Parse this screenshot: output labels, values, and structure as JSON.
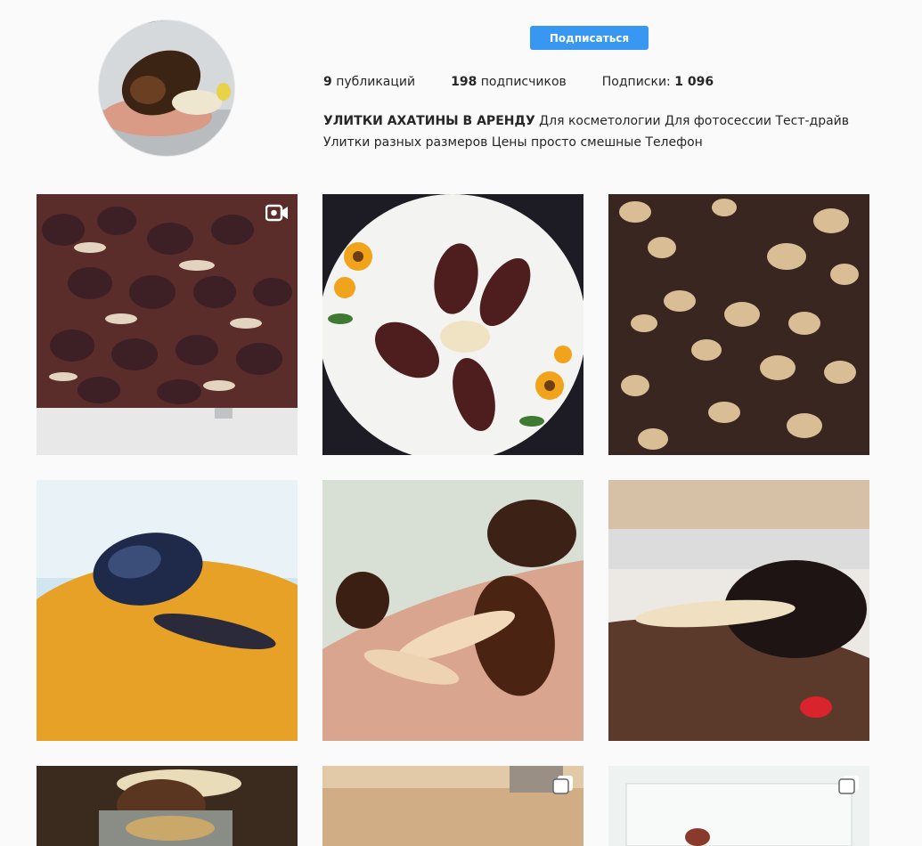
{
  "profile": {
    "follow_label": "Подписаться",
    "stats": [
      {
        "count": "9",
        "label": "публикаций"
      },
      {
        "count": "198",
        "label": "подписчиков"
      },
      {
        "label_prefix": "Подписки:",
        "count": "1 096"
      }
    ],
    "bio_title": "УЛИТКИ АХАТИНЫ В АРЕНДУ",
    "bio_text_1": " Для косметологии Для фотосессии Тест-драйв",
    "bio_text_2": "Улитки разных размеров Цены просто смешные Телефон"
  },
  "posts": [
    {
      "name": "post-snails-pile",
      "badge": "video-icon"
    },
    {
      "name": "post-snails-plate",
      "badge": null
    },
    {
      "name": "post-baby-snails-soil",
      "badge": null
    },
    {
      "name": "post-snail-orange-lid",
      "badge": null
    },
    {
      "name": "post-snails-on-arm",
      "badge": null
    },
    {
      "name": "post-snail-on-hand",
      "badge": null
    },
    {
      "name": "post-snail-food",
      "badge": null
    },
    {
      "name": "post-snail-closeup",
      "badge": "carousel-icon"
    },
    {
      "name": "post-snail-white-tray",
      "badge": "carousel-icon"
    }
  ],
  "colors": {
    "accent": "#3897f0",
    "background": "#fafafa"
  }
}
